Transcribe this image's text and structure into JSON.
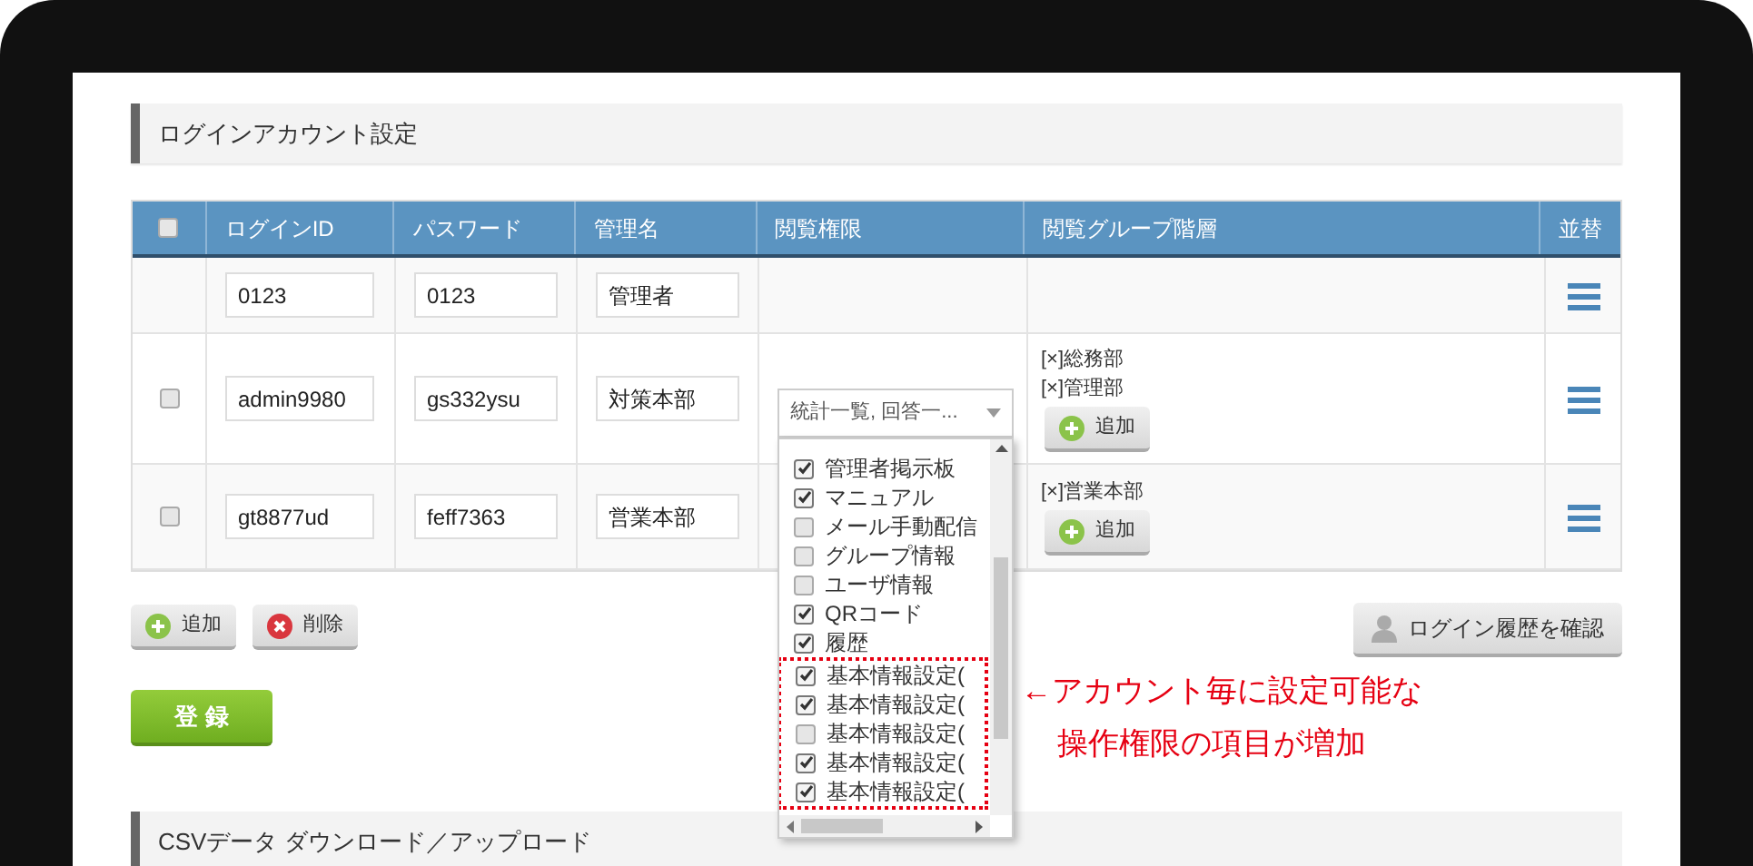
{
  "section_title": "ログインアカウント設定",
  "table": {
    "select_all": {
      "checked": false
    },
    "columns": [
      "ログインID",
      "パスワード",
      "管理名",
      "閲覧権限",
      "閲覧グループ階層",
      "並替"
    ],
    "rows": [
      {
        "login_id": "0123",
        "password": "0123",
        "admin_name": "管理者",
        "groups": [],
        "add_label": null
      },
      {
        "checked": false,
        "login_id": "admin9980",
        "password": "gs332ysu",
        "admin_name": "対策本部",
        "permission": "統計一覧, 回答一...",
        "groups": [
          "[×]総務部",
          "[×]管理部"
        ],
        "add_label": "追加"
      },
      {
        "checked": false,
        "login_id": "gt8877ud",
        "password": "feff7363",
        "admin_name": "営業本部",
        "groups": [
          "[×]営業本部"
        ],
        "add_label": "追加"
      }
    ]
  },
  "dropdown": {
    "options": [
      {
        "label": "管理者掲示板",
        "checked": true,
        "in_callout": false
      },
      {
        "label": "マニュアル",
        "checked": true,
        "in_callout": false
      },
      {
        "label": "メール手動配信",
        "checked": false,
        "in_callout": false
      },
      {
        "label": "グループ情報",
        "checked": false,
        "in_callout": false
      },
      {
        "label": "ユーザ情報",
        "checked": false,
        "in_callout": false
      },
      {
        "label": "QRコード",
        "checked": true,
        "in_callout": false
      },
      {
        "label": "履歴",
        "checked": true,
        "in_callout": false
      },
      {
        "label": "基本情報設定(",
        "checked": true,
        "in_callout": true
      },
      {
        "label": "基本情報設定(",
        "checked": true,
        "in_callout": true
      },
      {
        "label": "基本情報設定(",
        "checked": false,
        "in_callout": true
      },
      {
        "label": "基本情報設定(",
        "checked": true,
        "in_callout": true
      },
      {
        "label": "基本情報設定(",
        "checked": true,
        "in_callout": true
      }
    ]
  },
  "annotation": [
    "←アカウント毎に設定可能な",
    "操作権限の項目が増加"
  ],
  "actions": {
    "add": "追加",
    "delete": "削除",
    "login_history": "ログイン履歴を確認"
  },
  "register_button": "登 録",
  "csv_section_title": "CSVデータ ダウンロード／アップロード"
}
